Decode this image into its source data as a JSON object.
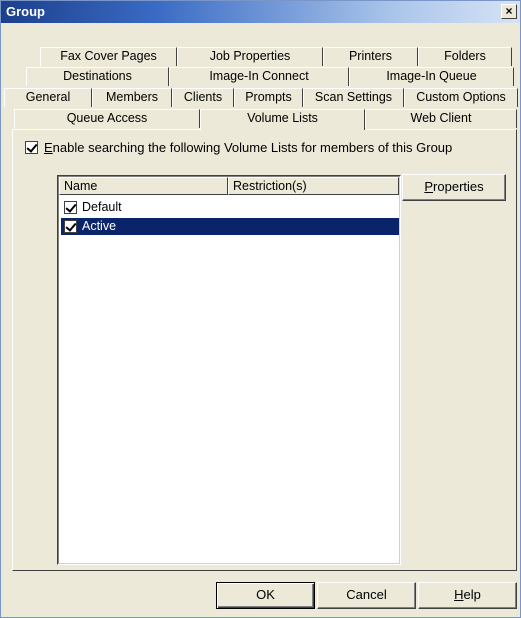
{
  "window": {
    "title": "Group",
    "close_glyph": "×"
  },
  "tabs": {
    "row1": [
      "Fax Cover Pages",
      "Job Properties",
      "Printers",
      "Folders"
    ],
    "row2": [
      "Destinations",
      "Image-In Connect",
      "Image-In Queue"
    ],
    "row3": [
      "General",
      "Members",
      "Clients",
      "Prompts",
      "Scan Settings",
      "Custom Options"
    ],
    "row4": [
      "Queue Access",
      "Volume Lists",
      "Web Client"
    ],
    "active": "Volume Lists"
  },
  "panel": {
    "enable_checkbox": {
      "checked": true,
      "label": "Enable searching the following Volume Lists for members of this Group"
    },
    "list": {
      "columns": [
        "Name",
        "Restriction(s)"
      ],
      "rows": [
        {
          "name": "Default",
          "restriction": "",
          "checked": true,
          "selected": false
        },
        {
          "name": "Active",
          "restriction": "",
          "checked": true,
          "selected": true
        }
      ]
    },
    "properties_button": "Properties"
  },
  "footer": {
    "ok": "OK",
    "cancel": "Cancel",
    "help": "Help"
  }
}
